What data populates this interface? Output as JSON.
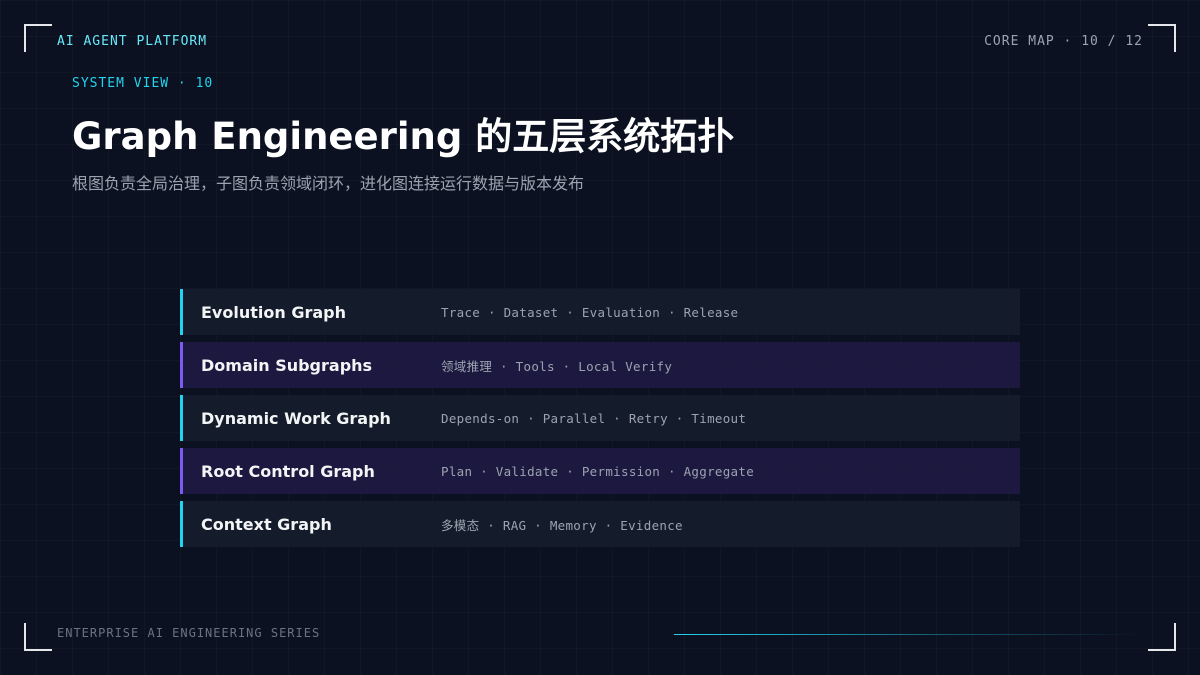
{
  "header": {
    "brand": "AI AGENT PLATFORM",
    "pager": "CORE MAP · 10 / 12"
  },
  "slide": {
    "kicker": "SYSTEM VIEW · 10",
    "title": "Graph Engineering 的五层系统拓扑",
    "subtitle": "根图负责全局治理，子图负责领域闭环，进化图连接运行数据与版本发布"
  },
  "layers": [
    {
      "name": "Evolution Graph",
      "tags": "Trace · Dataset · Evaluation · Release"
    },
    {
      "name": "Domain Subgraphs",
      "tags": "领域推理 · Tools · Local Verify"
    },
    {
      "name": "Dynamic Work Graph",
      "tags": "Depends-on · Parallel · Retry · Timeout"
    },
    {
      "name": "Root Control Graph",
      "tags": "Plan · Validate · Permission · Aggregate"
    },
    {
      "name": "Context Graph",
      "tags": "多模态 · RAG · Memory · Evidence"
    }
  ],
  "footer": {
    "series": "ENTERPRISE AI ENGINEERING SERIES"
  },
  "colors": {
    "background": "#0b1120",
    "accent_cyan": "#22d3ee",
    "accent_violet": "#7c5cf0"
  }
}
